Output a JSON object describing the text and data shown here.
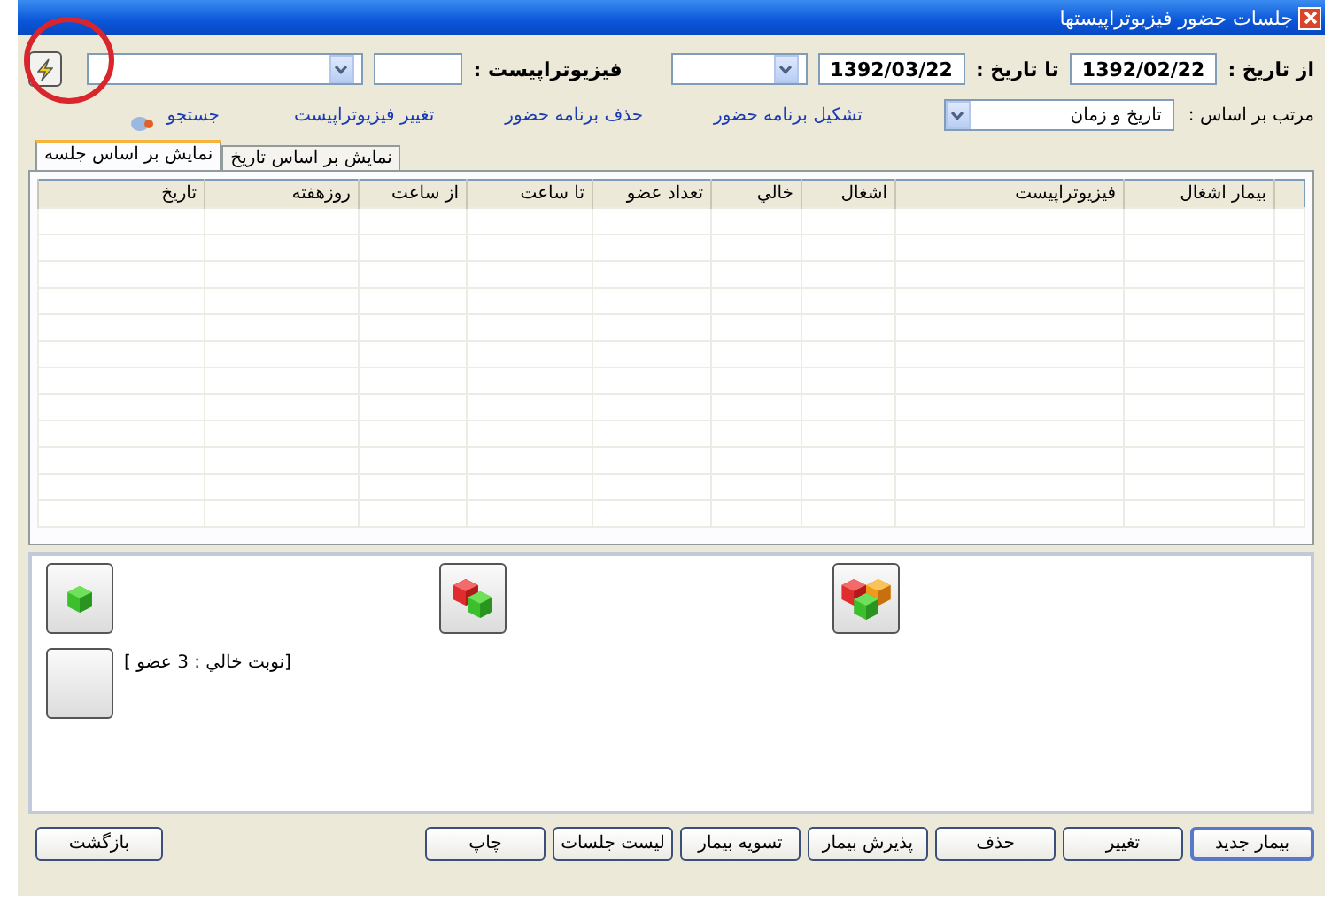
{
  "window": {
    "title": "جلسات حضور فيزيوتراپيستها"
  },
  "filters": {
    "from_label": "از تاريخ :",
    "from_date": "1392/02/22",
    "to_label": "تا تاريخ :",
    "to_date": "1392/03/22",
    "therapist_label": "فيزيوتراپيست :"
  },
  "sort": {
    "label": "مرتب بر اساس :",
    "value": "تاريخ و زمان"
  },
  "links": [
    "تشكيل برنامه حضور",
    "حذف برنامه حضور",
    "تغيير فيزيوتراپيست",
    "جستجو"
  ],
  "tabs": [
    {
      "label": "نمايش بر اساس تاريخ",
      "selected": false
    },
    {
      "label": "نمايش بر اساس جلسه",
      "selected": true
    }
  ],
  "table": {
    "columns": [
      "بيمار اشغال",
      "فيزيوتراپيست",
      "اشغال",
      "خالي",
      "تعداد عضو",
      "تا ساعت",
      "از ساعت",
      "روزهفته",
      "تاريخ"
    ]
  },
  "sessions": [
    {
      "kind": "green"
    },
    {
      "kind": "red-green"
    },
    {
      "kind": "three"
    },
    {
      "kind": "empty",
      "label": "[نوبت خالي : 3 عضو ]"
    }
  ],
  "buttons": [
    {
      "label": "بيمار جديد",
      "selected": true
    },
    {
      "label": "تغيير",
      "selected": false
    },
    {
      "label": "حذف",
      "selected": false
    },
    {
      "label": "پذيرش بيمار",
      "selected": false
    },
    {
      "label": "تسويه بيمار",
      "selected": false
    },
    {
      "label": "ليست جلسات",
      "selected": false
    },
    {
      "label": "چاپ",
      "selected": false
    }
  ],
  "back_button": "بازگشت"
}
